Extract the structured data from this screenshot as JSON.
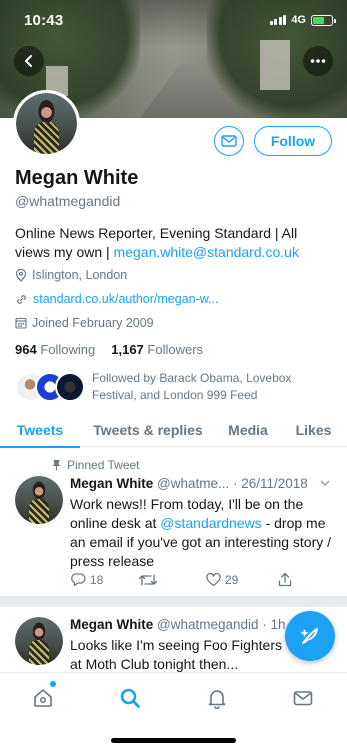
{
  "status_bar": {
    "time": "10:43",
    "network": "4G"
  },
  "profile": {
    "name": "Megan White",
    "handle": "@whatmegandid",
    "bio_text": "Online News Reporter, Evening Standard | All views my own | ",
    "bio_link": "megan.white@standard.co.uk",
    "location": "Islington, London",
    "website": "standard.co.uk/author/megan-w...",
    "joined": "Joined February 2009",
    "following_count": "964",
    "following_label": "Following",
    "followers_count": "1,167",
    "followers_label": "Followers",
    "followed_by": "Followed by Barack Obama, Lovebox Festival, and London 999 Feed",
    "follow_button": "Follow"
  },
  "tabs": [
    {
      "label": "Tweets",
      "active": true
    },
    {
      "label": "Tweets & replies",
      "active": false
    },
    {
      "label": "Media",
      "active": false
    },
    {
      "label": "Likes",
      "active": false
    }
  ],
  "tweets": [
    {
      "pinned_label": "Pinned Tweet",
      "name": "Megan White",
      "handle_date": "@whatme... · 26/11/2018",
      "body_1": "Work news!! From today, I'll be on the online desk at ",
      "mention": "@standardnews",
      "body_2": " - drop me an email if you've got an interesting story / press release",
      "replies": "18",
      "retweets": "",
      "likes": "29"
    },
    {
      "name": "Megan White",
      "handle_date": "@whatmegandid · 1h",
      "body": "Looks like I'm seeing Foo Fighters at Moth Club tonight then..."
    }
  ],
  "bottom_nav": [
    {
      "icon": "home-icon"
    },
    {
      "icon": "search-icon"
    },
    {
      "icon": "notifications-icon"
    },
    {
      "icon": "messages-icon"
    }
  ],
  "colors": {
    "accent": "#1da1f2",
    "text": "#14171a",
    "muted": "#657786",
    "border": "#e6ecf0"
  }
}
